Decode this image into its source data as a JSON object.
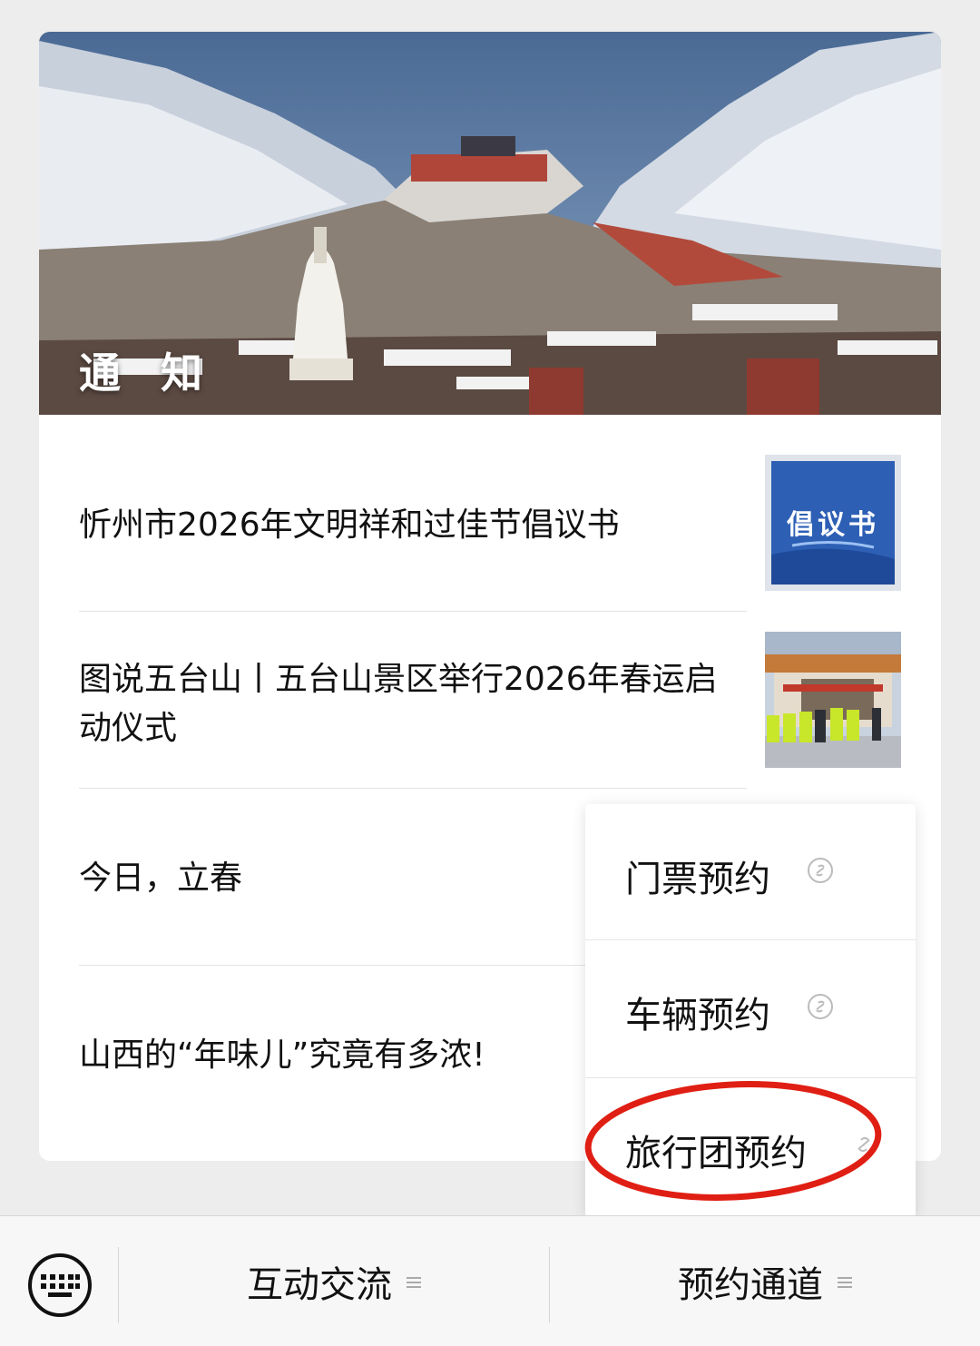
{
  "header_label": "通 知",
  "articles": [
    {
      "title": "忻州市2026年文明祥和过佳节倡议书",
      "thumb_text": "倡议书"
    },
    {
      "title": "图说五台山丨五台山景区举行2026年春运启动仪式"
    },
    {
      "title": "今日，立春"
    },
    {
      "title": "山西的“年味儿”究竟有多浓!"
    }
  ],
  "menu": {
    "items": [
      {
        "label": "门票预约",
        "icon": "link-icon"
      },
      {
        "label": "车辆预约",
        "icon": "link-icon"
      },
      {
        "label": "旅行团预约",
        "icon": "link-icon",
        "highlighted": true
      }
    ],
    "highlight_color": "#e01f14"
  },
  "bottom_bar": {
    "keyboard_icon": "keyboard-icon",
    "tabs": [
      {
        "label": "互动交流",
        "icon": "menu-lines-icon"
      },
      {
        "label": "预约通道",
        "icon": "menu-lines-icon"
      }
    ]
  }
}
